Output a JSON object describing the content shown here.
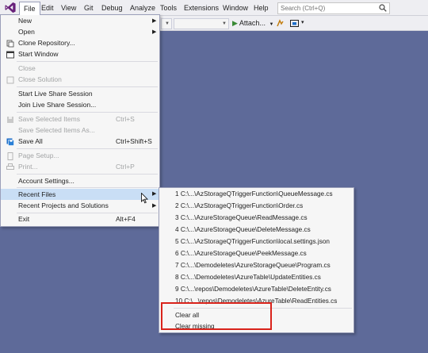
{
  "menubar": {
    "items": [
      "File",
      "Edit",
      "View",
      "Git",
      "Debug",
      "Analyze",
      "Tools",
      "Extensions",
      "Window",
      "Help"
    ],
    "search_placeholder": "Search (Ctrl+Q)"
  },
  "toolbar": {
    "attach_label": "Attach..."
  },
  "file_menu": {
    "items": [
      {
        "label": "New",
        "shortcut": "",
        "submenu": true,
        "disabled": false,
        "icon": ""
      },
      {
        "label": "Open",
        "shortcut": "",
        "submenu": true,
        "disabled": false,
        "icon": ""
      },
      {
        "label": "Clone Repository...",
        "shortcut": "",
        "submenu": false,
        "disabled": false,
        "icon": "clone-repo-icon"
      },
      {
        "label": "Start Window",
        "shortcut": "",
        "submenu": false,
        "disabled": false,
        "icon": "start-window-icon"
      },
      {
        "label": "Close",
        "shortcut": "",
        "submenu": false,
        "disabled": true,
        "icon": ""
      },
      {
        "label": "Close Solution",
        "shortcut": "",
        "submenu": false,
        "disabled": true,
        "icon": "close-solution-icon"
      },
      {
        "label": "Start Live Share Session",
        "shortcut": "",
        "submenu": false,
        "disabled": false,
        "icon": ""
      },
      {
        "label": "Join Live Share Session...",
        "shortcut": "",
        "submenu": false,
        "disabled": false,
        "icon": ""
      },
      {
        "label": "Save Selected Items",
        "shortcut": "Ctrl+S",
        "submenu": false,
        "disabled": true,
        "icon": "save-icon"
      },
      {
        "label": "Save Selected Items As...",
        "shortcut": "",
        "submenu": false,
        "disabled": true,
        "icon": ""
      },
      {
        "label": "Save All",
        "shortcut": "Ctrl+Shift+S",
        "submenu": false,
        "disabled": false,
        "icon": "save-all-icon"
      },
      {
        "label": "Page Setup...",
        "shortcut": "",
        "submenu": false,
        "disabled": true,
        "icon": "page-setup-icon"
      },
      {
        "label": "Print...",
        "shortcut": "Ctrl+P",
        "submenu": false,
        "disabled": true,
        "icon": "print-icon"
      },
      {
        "label": "Account Settings...",
        "shortcut": "",
        "submenu": false,
        "disabled": false,
        "icon": ""
      },
      {
        "label": "Recent Files",
        "shortcut": "",
        "submenu": true,
        "disabled": false,
        "icon": ""
      },
      {
        "label": "Recent Projects and Solutions",
        "shortcut": "",
        "submenu": true,
        "disabled": false,
        "icon": ""
      },
      {
        "label": "Exit",
        "shortcut": "Alt+F4",
        "submenu": false,
        "disabled": false,
        "icon": ""
      }
    ]
  },
  "recent_files": {
    "items": [
      "1 C:\\...\\AzStorageQTriggerFunction\\QueueMessage.cs",
      "2 C:\\...\\AzStorageQTriggerFunction\\Order.cs",
      "3 C:\\...\\AzureStorageQueue\\ReadMessage.cs",
      "4 C:\\...\\AzureStorageQueue\\DeleteMessage.cs",
      "5 C:\\...\\AzStorageQTriggerFunction\\local.settings.json",
      "6 C:\\...\\AzureStorageQueue\\PeekMessage.cs",
      "7 C:\\...\\Demodeletes\\AzureStorageQueue\\Program.cs",
      "8 C:\\...\\Demodeletes\\AzureTable\\UpdateEntities.cs",
      "9 C:\\...\\repos\\Demodeletes\\AzureTable\\DeleteEntity.cs",
      "10 C:\\...\\repos\\Demodeletes\\AzureTable\\ReadEntities.cs"
    ],
    "clear_all": "Clear all",
    "clear_missing": "Clear missing"
  },
  "colors": {
    "background": "#5e6a99",
    "highlight": "#c9def5",
    "annotation_box": "#d9231b",
    "vs_logo": "#68217a"
  }
}
